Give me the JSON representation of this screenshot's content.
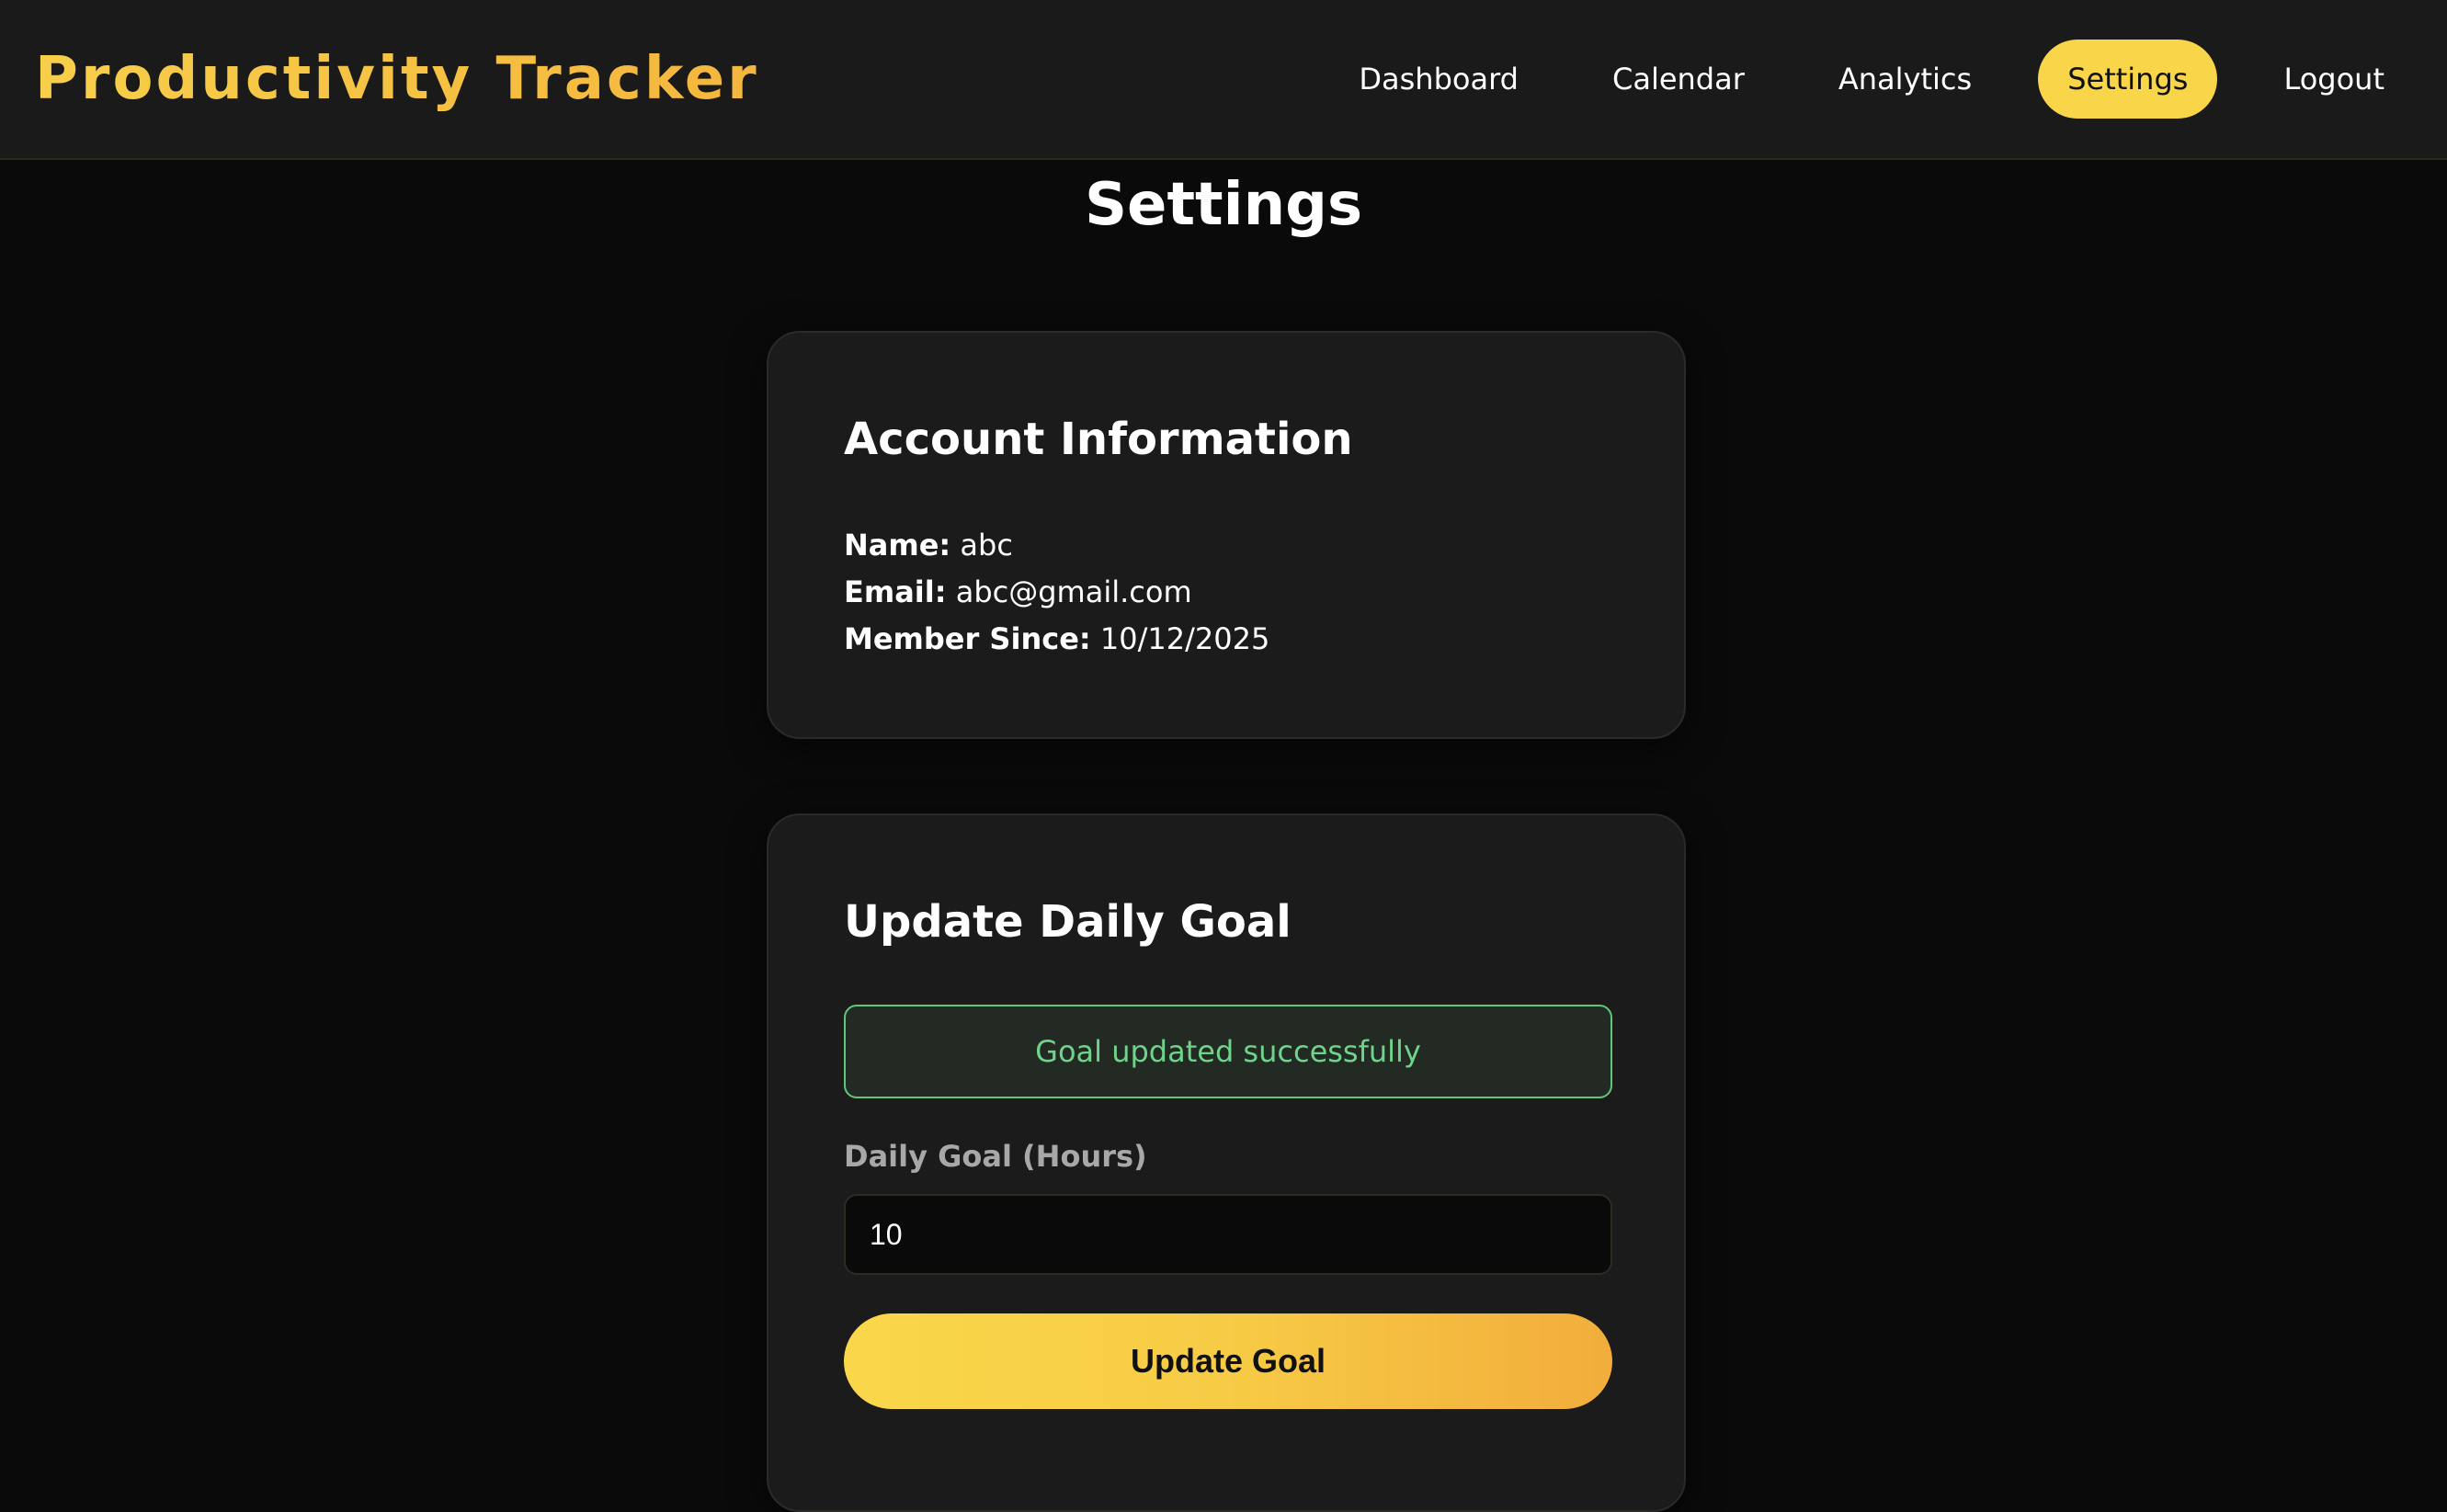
{
  "app": {
    "brand": "Productivity Tracker"
  },
  "nav": {
    "items": [
      {
        "label": "Dashboard",
        "active": false
      },
      {
        "label": "Calendar",
        "active": false
      },
      {
        "label": "Analytics",
        "active": false
      },
      {
        "label": "Settings",
        "active": true
      },
      {
        "label": "Logout",
        "active": false
      }
    ]
  },
  "page": {
    "title": "Settings"
  },
  "account": {
    "title": "Account Information",
    "name_label": "Name:",
    "name_value": "abc",
    "email_label": "Email:",
    "email_value": "abc@gmail.com",
    "member_label": "Member Since:",
    "member_value": "10/12/2025"
  },
  "goal": {
    "title": "Update Daily Goal",
    "alert": "Goal updated successfully",
    "field_label": "Daily Goal (Hours)",
    "value": "10",
    "button": "Update Goal"
  },
  "colors": {
    "accent": "#f9d54a",
    "accent_end": "#f2ad3c",
    "success": "#6fd48a",
    "background": "#0a0a0a",
    "card": "#1b1b1b"
  }
}
